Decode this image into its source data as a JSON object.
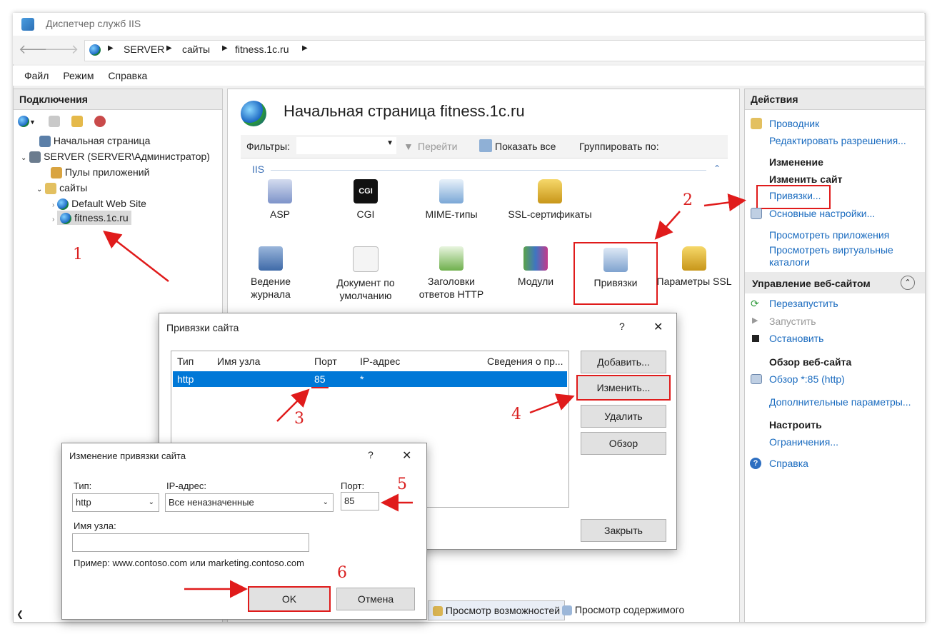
{
  "window": {
    "title": "Диспетчер служб IIS"
  },
  "address": {
    "crumbs": [
      "SERVER",
      "сайты",
      "fitness.1c.ru"
    ]
  },
  "menu": [
    "Файл",
    "Режим",
    "Справка"
  ],
  "connections": {
    "header": "Подключения",
    "tree": {
      "home": "Начальная страница",
      "server": "SERVER (SERVER\\Администратор)",
      "pools": "Пулы приложений",
      "sites": "сайты",
      "default_site": "Default Web Site",
      "fitness": "fitness.1c.ru"
    }
  },
  "center": {
    "title": "Начальная страница fitness.1c.ru",
    "filter_label": "Фильтры:",
    "go_label": "Перейти",
    "show_all": "Показать все",
    "group_by": "Группировать по:",
    "section": "IIS",
    "features": [
      {
        "label": "ASP"
      },
      {
        "label": "CGI"
      },
      {
        "label": "MIME-типы"
      },
      {
        "label": "SSL-сертификаты"
      },
      {
        "label": "Ведение журнала"
      },
      {
        "label": "Документ по умолчанию"
      },
      {
        "label": "Заголовки ответов HTTP"
      },
      {
        "label": "Модули"
      },
      {
        "label": "Привязки"
      },
      {
        "label": "Параметры SSL"
      }
    ],
    "bottom_tabs": {
      "features": "Просмотр возможностей",
      "content": "Просмотр содержимого"
    }
  },
  "actions": {
    "header": "Действия",
    "explorer": "Проводник",
    "edit_permissions": "Редактировать разрешения...",
    "change_header": "Изменение",
    "change_site": "Изменить сайт",
    "bindings": "Привязки...",
    "basic_settings": "Основные настройки...",
    "view_apps": "Просмотреть приложения",
    "view_vdirs": "Просмотреть виртуальные каталоги",
    "manage_header": "Управление веб-сайтом",
    "restart": "Перезапустить",
    "start": "Запустить",
    "stop": "Остановить",
    "browse_header": "Обзор веб-сайта",
    "browse_link": "Обзор *:85 (http)",
    "advanced": "Дополнительные параметры...",
    "configure_header": "Настроить",
    "limits": "Ограничения...",
    "help": "Справка"
  },
  "bindings_dialog": {
    "title": "Привязки сайта",
    "help": "?",
    "close": "✕",
    "columns": [
      "Тип",
      "Имя узла",
      "Порт",
      "IP-адрес",
      "Сведения о пр..."
    ],
    "rows": [
      {
        "type": "http",
        "host": "",
        "port": "85",
        "ip": "*",
        "info": ""
      }
    ],
    "buttons": {
      "add": "Добавить...",
      "edit": "Изменить...",
      "remove": "Удалить",
      "browse": "Обзор",
      "close": "Закрыть"
    }
  },
  "edit_dialog": {
    "title": "Изменение привязки сайта",
    "help": "?",
    "close": "✕",
    "type_label": "Тип:",
    "type_value": "http",
    "ip_label": "IP-адрес:",
    "ip_value": "Все неназначенные",
    "port_label": "Порт:",
    "port_value": "85",
    "host_label": "Имя узла:",
    "host_value": "",
    "example": "Пример: www.contoso.com или marketing.contoso.com",
    "ok": "OK",
    "cancel": "Отмена"
  },
  "annotations": [
    "1",
    "2",
    "3",
    "4",
    "5",
    "6"
  ],
  "colors": {
    "accent": "#1a6bbf",
    "annotation": "#e01b1b",
    "selection": "#0078d7"
  }
}
